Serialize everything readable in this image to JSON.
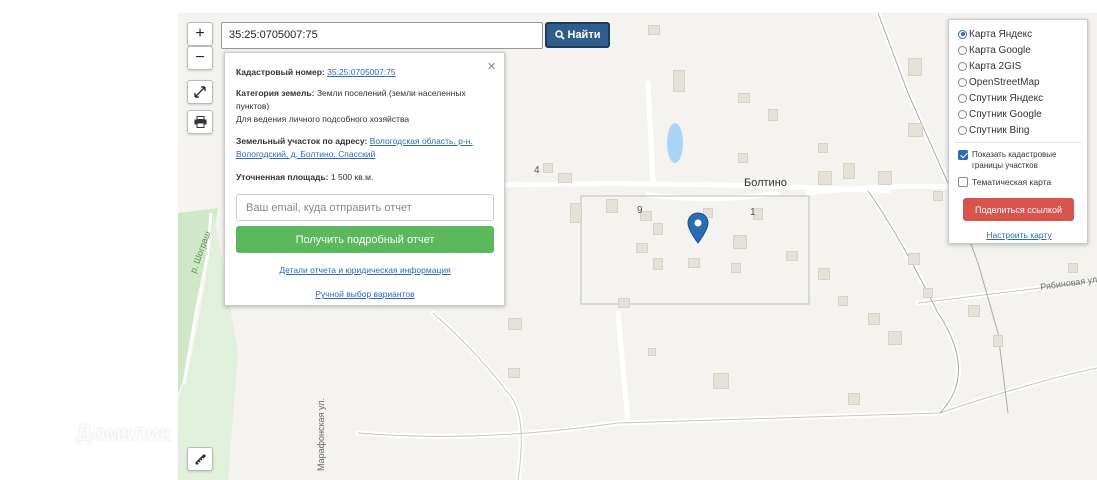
{
  "search": {
    "value": "35:25:0705007:75",
    "button_label": "Найти"
  },
  "zoom": {
    "plus": "+",
    "minus": "−"
  },
  "info": {
    "cadastral_label": "Кадастровый номер:",
    "cadastral_value": "35:25:0705007:75",
    "category_label": "Категория земель:",
    "category_value": "Земли поселений (земли населенных пунктов)",
    "usage": "Для ведения личного подсобного хозяйства",
    "address_label": "Земельный участок по адресу:",
    "address_value": "Вологодская область, р-н. Вологодский, д. Болтино, Спасский",
    "area_label": "Уточненная площадь:",
    "area_value": "1 500 кв.м.",
    "email_placeholder": "Ваш email, куда отправить отчет",
    "report_button": "Получить подробный отчет",
    "details_link": "Детали отчета и юридическая информация",
    "manual_link": "Ручной выбор вариантов",
    "close": "×"
  },
  "layers": {
    "options": [
      "Карта Яндекс",
      "Карта Google",
      "Карта 2GIS",
      "OpenStreetMap",
      "Спутник Яндекс",
      "Спутник Google",
      "Спутник Bing"
    ],
    "selected": "Карта Яндекс",
    "show_borders_label": "Показать кадастровые границы участков",
    "thematic_label": "Тематическая карта",
    "share_button": "Поделиться ссылкой",
    "configure_link": "Настроить карту"
  },
  "map_labels": {
    "village": "Болтино",
    "street_rabinovaya": "Рябиновая ул.",
    "street_marafonskaya": "Марафонская ул.",
    "street_green": "р. Шограш",
    "num_4": "4",
    "num_9": "9",
    "num_1": "1"
  },
  "watermark": "Домклик",
  "colors": {
    "accent": "#2f5d8c",
    "report": "#5cb85c",
    "share": "#d9534f",
    "pin": "#2b6cb5",
    "forest": "#cfe8c8"
  }
}
